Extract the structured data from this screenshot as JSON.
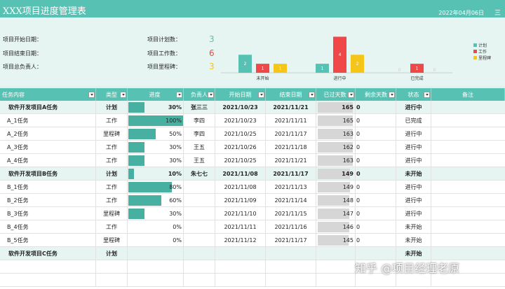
{
  "header": {
    "title": "XXX项目进度管理表",
    "date": "2022年04月06日",
    "menu_icon": "三"
  },
  "summary": {
    "labels": {
      "start_date": "项目开始日期：",
      "end_date": "项目结束日期：",
      "owner": "项目总负责人：",
      "plan_count": "项目计划数：",
      "work_count": "项目工作数：",
      "milestone_count": "项目里程碑："
    },
    "values": {
      "plan_count": "3",
      "work_count": "6",
      "milestone_count": "3"
    },
    "value_colors": {
      "plan_count": "#57c2b3",
      "work_count": "#f04848",
      "milestone_count": "#f5c518"
    }
  },
  "chart_data": {
    "type": "bar",
    "categories": [
      "未开始",
      "进行中",
      "已完成"
    ],
    "series": [
      {
        "name": "计划",
        "values": [
          2,
          1,
          0
        ],
        "color": "#57c2b3"
      },
      {
        "name": "工作",
        "values": [
          1,
          4,
          1
        ],
        "color": "#f04848"
      },
      {
        "name": "里程碑",
        "values": [
          1,
          2,
          0
        ],
        "color": "#f5c518"
      }
    ],
    "ylim": [
      0,
      4.5
    ],
    "legend_position": "right"
  },
  "table": {
    "columns": [
      "任务内容",
      "类型",
      "进度",
      "负责人",
      "开始日期",
      "结束日期",
      "已过天数",
      "剩余天数",
      "状态",
      "备注"
    ],
    "rows": [
      {
        "kind": "group",
        "name": "软件开发项目A任务",
        "type": "计划",
        "progress": 0.3,
        "progress_text": "30%",
        "owner": "张三三",
        "start": "2021/10/23",
        "end": "2021/11/21",
        "elapsed": 165,
        "elapsed_text": "165",
        "remain": "0",
        "status": "进行中"
      },
      {
        "kind": "item",
        "name": "A_1任务",
        "type": "工作",
        "progress": 1.0,
        "progress_text": "100%",
        "owner": "李四",
        "start": "2021/10/23",
        "end": "2021/11/11",
        "elapsed": 165,
        "elapsed_text": "165",
        "remain": "0",
        "status": "已完成"
      },
      {
        "kind": "item",
        "name": "A_2任务",
        "type": "里程碑",
        "progress": 0.5,
        "progress_text": "50%",
        "owner": "李四",
        "start": "2021/10/25",
        "end": "2021/11/17",
        "elapsed": 163,
        "elapsed_text": "163",
        "remain": "0",
        "status": "进行中"
      },
      {
        "kind": "item",
        "name": "A_3任务",
        "type": "工作",
        "progress": 0.3,
        "progress_text": "30%",
        "owner": "王五",
        "start": "2021/10/26",
        "end": "2021/11/18",
        "elapsed": 162,
        "elapsed_text": "162",
        "remain": "0",
        "status": "进行中"
      },
      {
        "kind": "item",
        "name": "A_4任务",
        "type": "工作",
        "progress": 0.3,
        "progress_text": "30%",
        "owner": "王五",
        "start": "2021/10/25",
        "end": "2021/11/21",
        "elapsed": 163,
        "elapsed_text": "163",
        "remain": "0",
        "status": "进行中"
      },
      {
        "kind": "group",
        "name": "软件开发项目B任务",
        "type": "计划",
        "progress": 0.1,
        "progress_text": "10%",
        "owner": "朱七七",
        "start": "2021/11/08",
        "end": "2021/11/17",
        "elapsed": 149,
        "elapsed_text": "149",
        "remain": "0",
        "status": "未开始"
      },
      {
        "kind": "item",
        "name": "B_1任务",
        "type": "工作",
        "progress": 0.8,
        "progress_text": "80%",
        "owner": "",
        "start": "2021/11/08",
        "end": "2021/11/13",
        "elapsed": 149,
        "elapsed_text": "149",
        "remain": "0",
        "status": "进行中"
      },
      {
        "kind": "item",
        "name": "B_2任务",
        "type": "工作",
        "progress": 0.6,
        "progress_text": "60%",
        "owner": "",
        "start": "2021/11/09",
        "end": "2021/11/14",
        "elapsed": 148,
        "elapsed_text": "148",
        "remain": "0",
        "status": "进行中"
      },
      {
        "kind": "item",
        "name": "B_3任务",
        "type": "里程碑",
        "progress": 0.3,
        "progress_text": "30%",
        "owner": "",
        "start": "2021/11/10",
        "end": "2021/11/15",
        "elapsed": 147,
        "elapsed_text": "147",
        "remain": "0",
        "status": "进行中"
      },
      {
        "kind": "item",
        "name": "B_4任务",
        "type": "工作",
        "progress": 0,
        "progress_text": "0%",
        "owner": "",
        "start": "2021/11/11",
        "end": "2021/11/16",
        "elapsed": 146,
        "elapsed_text": "146",
        "remain": "0",
        "status": "未开始"
      },
      {
        "kind": "item",
        "name": "B_5任务",
        "type": "里程碑",
        "progress": 0,
        "progress_text": "0%",
        "owner": "",
        "start": "2021/11/12",
        "end": "2021/11/17",
        "elapsed": 145,
        "elapsed_text": "145",
        "remain": "0",
        "status": "未开始"
      },
      {
        "kind": "group",
        "name": "软件开发项目C任务",
        "type": "计划",
        "progress": null,
        "progress_text": "",
        "owner": "",
        "start": "",
        "end": "",
        "elapsed": null,
        "elapsed_text": "",
        "remain": "",
        "status": "未开始"
      },
      {
        "kind": "empty"
      },
      {
        "kind": "empty"
      }
    ]
  },
  "watermark": "知乎 @项目经理老原"
}
